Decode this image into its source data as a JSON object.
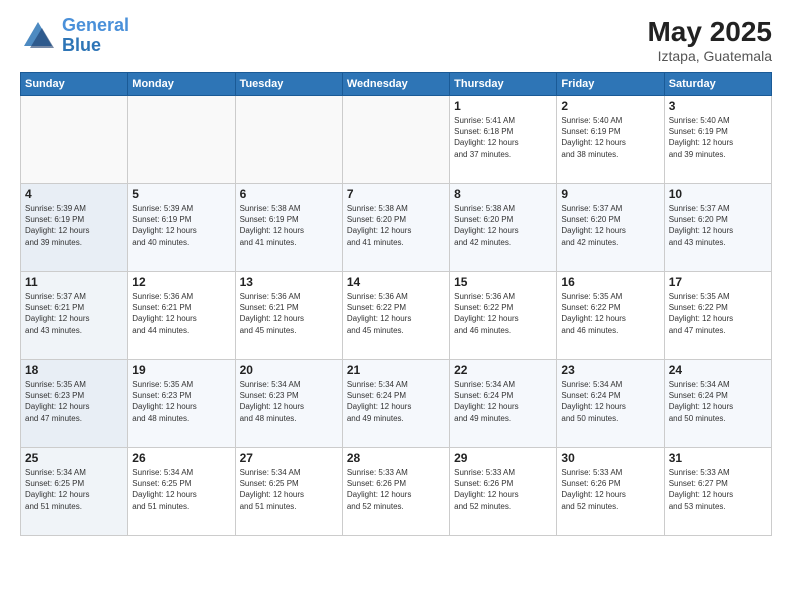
{
  "header": {
    "logo_line1": "General",
    "logo_line2": "Blue",
    "month": "May 2025",
    "location": "Iztapa, Guatemala"
  },
  "weekdays": [
    "Sunday",
    "Monday",
    "Tuesday",
    "Wednesday",
    "Thursday",
    "Friday",
    "Saturday"
  ],
  "weeks": [
    [
      {
        "day": "",
        "info": ""
      },
      {
        "day": "",
        "info": ""
      },
      {
        "day": "",
        "info": ""
      },
      {
        "day": "",
        "info": ""
      },
      {
        "day": "1",
        "info": "Sunrise: 5:41 AM\nSunset: 6:18 PM\nDaylight: 12 hours\nand 37 minutes."
      },
      {
        "day": "2",
        "info": "Sunrise: 5:40 AM\nSunset: 6:19 PM\nDaylight: 12 hours\nand 38 minutes."
      },
      {
        "day": "3",
        "info": "Sunrise: 5:40 AM\nSunset: 6:19 PM\nDaylight: 12 hours\nand 39 minutes."
      }
    ],
    [
      {
        "day": "4",
        "info": "Sunrise: 5:39 AM\nSunset: 6:19 PM\nDaylight: 12 hours\nand 39 minutes."
      },
      {
        "day": "5",
        "info": "Sunrise: 5:39 AM\nSunset: 6:19 PM\nDaylight: 12 hours\nand 40 minutes."
      },
      {
        "day": "6",
        "info": "Sunrise: 5:38 AM\nSunset: 6:19 PM\nDaylight: 12 hours\nand 41 minutes."
      },
      {
        "day": "7",
        "info": "Sunrise: 5:38 AM\nSunset: 6:20 PM\nDaylight: 12 hours\nand 41 minutes."
      },
      {
        "day": "8",
        "info": "Sunrise: 5:38 AM\nSunset: 6:20 PM\nDaylight: 12 hours\nand 42 minutes."
      },
      {
        "day": "9",
        "info": "Sunrise: 5:37 AM\nSunset: 6:20 PM\nDaylight: 12 hours\nand 42 minutes."
      },
      {
        "day": "10",
        "info": "Sunrise: 5:37 AM\nSunset: 6:20 PM\nDaylight: 12 hours\nand 43 minutes."
      }
    ],
    [
      {
        "day": "11",
        "info": "Sunrise: 5:37 AM\nSunset: 6:21 PM\nDaylight: 12 hours\nand 43 minutes."
      },
      {
        "day": "12",
        "info": "Sunrise: 5:36 AM\nSunset: 6:21 PM\nDaylight: 12 hours\nand 44 minutes."
      },
      {
        "day": "13",
        "info": "Sunrise: 5:36 AM\nSunset: 6:21 PM\nDaylight: 12 hours\nand 45 minutes."
      },
      {
        "day": "14",
        "info": "Sunrise: 5:36 AM\nSunset: 6:22 PM\nDaylight: 12 hours\nand 45 minutes."
      },
      {
        "day": "15",
        "info": "Sunrise: 5:36 AM\nSunset: 6:22 PM\nDaylight: 12 hours\nand 46 minutes."
      },
      {
        "day": "16",
        "info": "Sunrise: 5:35 AM\nSunset: 6:22 PM\nDaylight: 12 hours\nand 46 minutes."
      },
      {
        "day": "17",
        "info": "Sunrise: 5:35 AM\nSunset: 6:22 PM\nDaylight: 12 hours\nand 47 minutes."
      }
    ],
    [
      {
        "day": "18",
        "info": "Sunrise: 5:35 AM\nSunset: 6:23 PM\nDaylight: 12 hours\nand 47 minutes."
      },
      {
        "day": "19",
        "info": "Sunrise: 5:35 AM\nSunset: 6:23 PM\nDaylight: 12 hours\nand 48 minutes."
      },
      {
        "day": "20",
        "info": "Sunrise: 5:34 AM\nSunset: 6:23 PM\nDaylight: 12 hours\nand 48 minutes."
      },
      {
        "day": "21",
        "info": "Sunrise: 5:34 AM\nSunset: 6:24 PM\nDaylight: 12 hours\nand 49 minutes."
      },
      {
        "day": "22",
        "info": "Sunrise: 5:34 AM\nSunset: 6:24 PM\nDaylight: 12 hours\nand 49 minutes."
      },
      {
        "day": "23",
        "info": "Sunrise: 5:34 AM\nSunset: 6:24 PM\nDaylight: 12 hours\nand 50 minutes."
      },
      {
        "day": "24",
        "info": "Sunrise: 5:34 AM\nSunset: 6:24 PM\nDaylight: 12 hours\nand 50 minutes."
      }
    ],
    [
      {
        "day": "25",
        "info": "Sunrise: 5:34 AM\nSunset: 6:25 PM\nDaylight: 12 hours\nand 51 minutes."
      },
      {
        "day": "26",
        "info": "Sunrise: 5:34 AM\nSunset: 6:25 PM\nDaylight: 12 hours\nand 51 minutes."
      },
      {
        "day": "27",
        "info": "Sunrise: 5:34 AM\nSunset: 6:25 PM\nDaylight: 12 hours\nand 51 minutes."
      },
      {
        "day": "28",
        "info": "Sunrise: 5:33 AM\nSunset: 6:26 PM\nDaylight: 12 hours\nand 52 minutes."
      },
      {
        "day": "29",
        "info": "Sunrise: 5:33 AM\nSunset: 6:26 PM\nDaylight: 12 hours\nand 52 minutes."
      },
      {
        "day": "30",
        "info": "Sunrise: 5:33 AM\nSunset: 6:26 PM\nDaylight: 12 hours\nand 52 minutes."
      },
      {
        "day": "31",
        "info": "Sunrise: 5:33 AM\nSunset: 6:27 PM\nDaylight: 12 hours\nand 53 minutes."
      }
    ]
  ]
}
